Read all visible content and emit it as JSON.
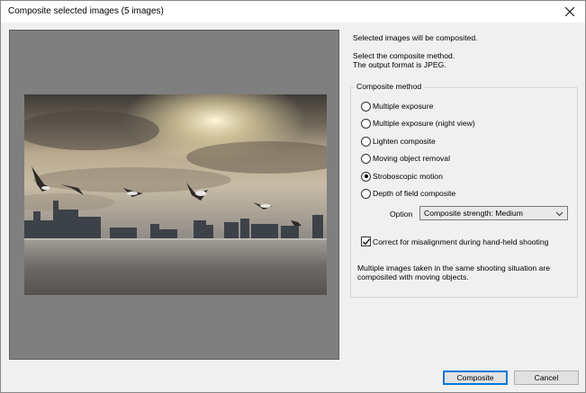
{
  "window": {
    "title": "Composite selected images (5 images)"
  },
  "info": {
    "line1": "Selected images will be composited.",
    "line2": "Select the composite method.",
    "line3": "The output format is JPEG."
  },
  "method": {
    "legend": "Composite method",
    "options": [
      {
        "label": "Multiple exposure",
        "selected": false
      },
      {
        "label": "Multiple exposure (night view)",
        "selected": false
      },
      {
        "label": "Lighten composite",
        "selected": false
      },
      {
        "label": "Moving object removal",
        "selected": false
      },
      {
        "label": "Stroboscopic motion",
        "selected": true
      },
      {
        "label": "Depth of field composite",
        "selected": false
      }
    ],
    "option_label": "Option",
    "option_value": "Composite strength: Medium",
    "misalignment_label": "Correct for misalignment during hand-held shooting",
    "misalignment_checked": true,
    "note": "Multiple images taken in the same shooting situation are composited with moving objects."
  },
  "buttons": {
    "composite": "Composite",
    "cancel": "Cancel"
  },
  "colors": {
    "accent": "#0078d7",
    "preview_bg": "#7f7f7f"
  }
}
